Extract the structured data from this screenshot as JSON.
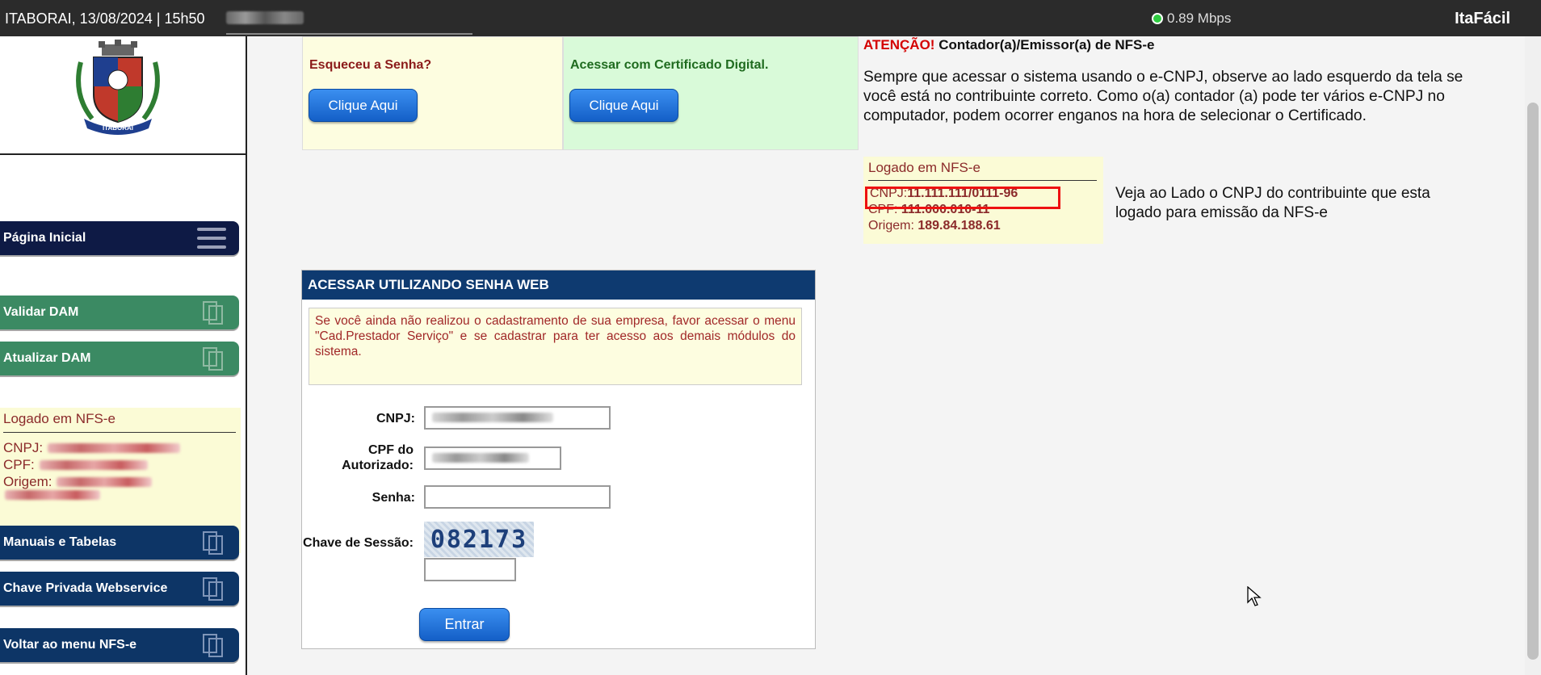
{
  "topbar": {
    "location_time": "ITABORAI, 13/08/2024  |  15h50",
    "speed": "0.89 Mbps",
    "brand": "ItaFácil"
  },
  "sidebar": {
    "logo_text": "ITABORAÍ",
    "nav_home": "Página Inicial",
    "nav_validar": "Validar DAM",
    "nav_atualizar": "Atualizar DAM",
    "login": {
      "title": "Logado em NFS-e",
      "cnpj_label": "CNPJ:",
      "cpf_label": "CPF:",
      "origem_label": "Origem:"
    },
    "nav_manuais": "Manuais e Tabelas",
    "nav_chave": "Chave Privada Webservice",
    "nav_voltar": "Voltar ao menu NFS-e"
  },
  "main": {
    "forgot": {
      "title": "Esqueceu a Senha?",
      "button": "Clique Aqui"
    },
    "cert": {
      "title": "Acessar com Certificado Digital.",
      "button": "Clique Aqui"
    },
    "atencao": {
      "label": "ATENÇÃO!",
      "heading": "Contador(a)/Emissor(a) de NFS-e",
      "text": "Sempre que acessar o sistema usando o e-CNPJ, observe ao lado esquerdo da tela se você está no contribuinte correto. Como o(a) contador (a) pode ter vários e-CNPJ no computador, podem ocorrer enganos na hora de selecionar o Certificado."
    },
    "example_login": {
      "title": "Logado em NFS-e",
      "cnpj_label": "CNPJ:",
      "cnpj_value": "11.111.111/0111-96",
      "cpf_label": "CPF:",
      "cpf_value": "111.000.010-11",
      "origem_label": "Origem:",
      "origem_value": "189.84.188.61"
    },
    "veja_text": "Veja ao Lado o CNPJ do contribuinte que esta logado para emissão da NFS-e",
    "form": {
      "header": "ACESSAR UTILIZANDO SENHA WEB",
      "message": "Se você ainda não realizou o cadastramento de sua empresa, favor acessar o menu \"Cad.Prestador Serviço\" e se cadastrar para ter acesso aos demais módulos do sistema.",
      "cnpj_label": "CNPJ:",
      "cpf_label": "CPF do Autorizado:",
      "senha_label": "Senha:",
      "chave_label": "Chave de Sessão:",
      "captcha": "082173",
      "submit": "Entrar"
    }
  },
  "colors": {
    "navy": "#0e1a45",
    "blue": "#0d3566",
    "green": "#3b8a63",
    "alert_red": "#d40000"
  }
}
